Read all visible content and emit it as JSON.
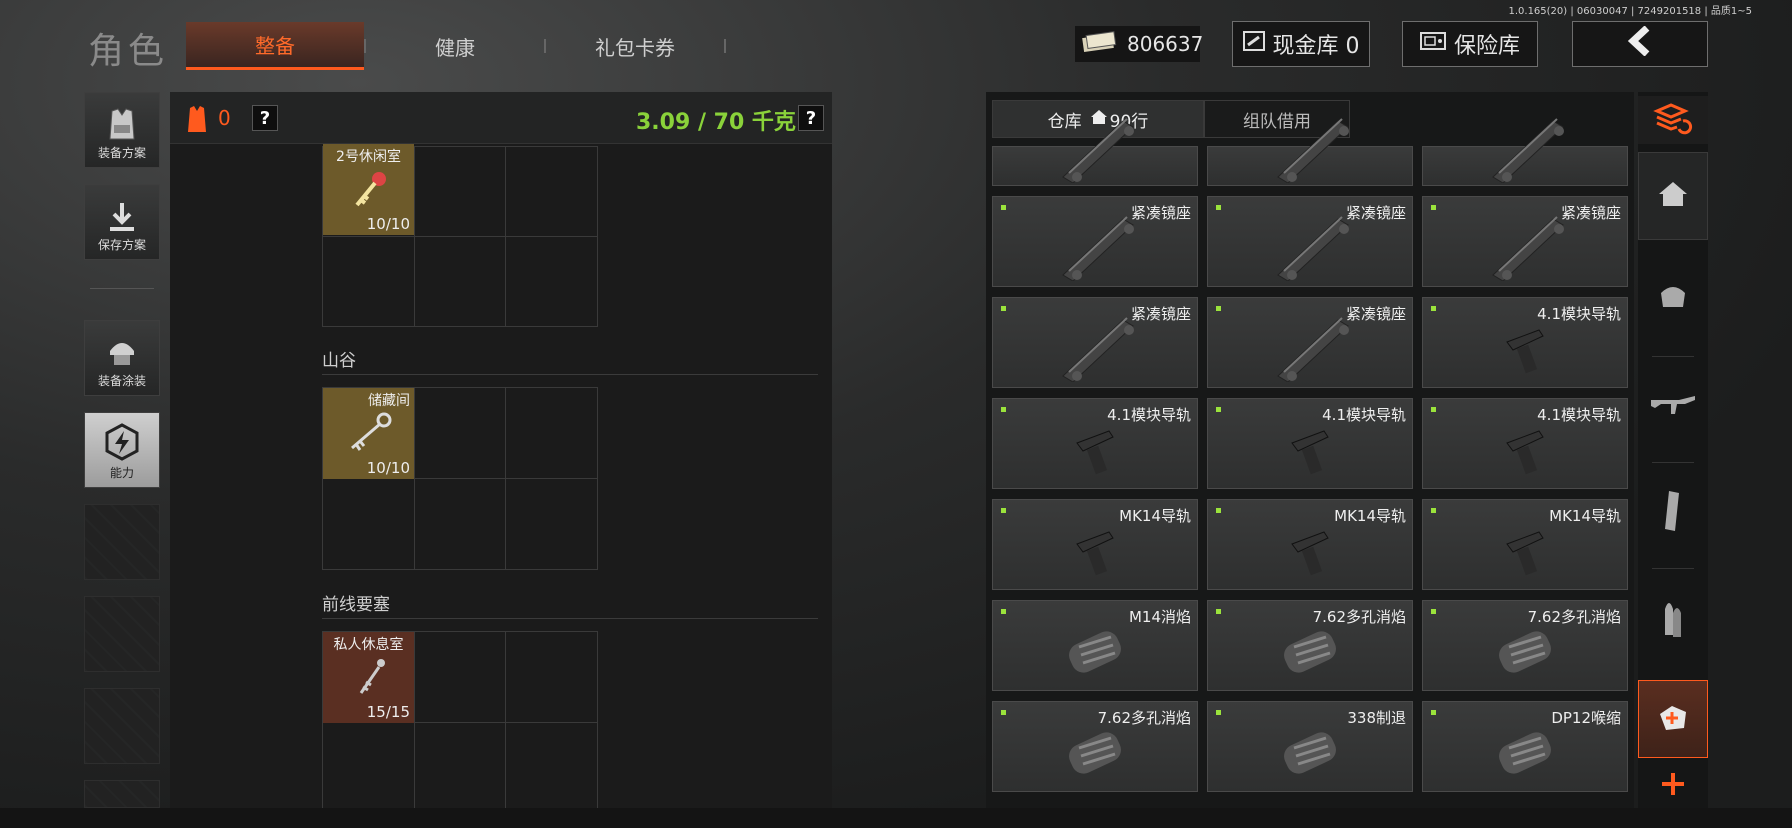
{
  "version": "1.0.165(20) | 06030047 | 7249201518 | 品质1~5",
  "header": {
    "title": "角色",
    "tabs": [
      {
        "label": "整备",
        "active": true
      },
      {
        "label": "健康",
        "active": false
      },
      {
        "label": "礼包卡券",
        "active": false
      }
    ],
    "money": "806637",
    "cash_vault": "现金库 0",
    "safe": "保险库",
    "back_icon": "chevron-left-icon"
  },
  "leftnav": [
    {
      "label": "装备方案",
      "icon": "vest-icon"
    },
    {
      "label": "保存方案",
      "icon": "download-icon"
    },
    {
      "label": "装备涂装",
      "icon": "helmet-icon"
    },
    {
      "label": "能力",
      "icon": "lightning-icon",
      "light": true
    }
  ],
  "equip": {
    "armor_count": "0",
    "help": "?",
    "weight": "3.09 / 70 千克",
    "sections": [
      {
        "title": "",
        "key_name": "2号休闲室",
        "key_count": "10/10",
        "color": "#6d5a2a"
      },
      {
        "title": "山谷",
        "key_name": "储藏间",
        "key_count": "10/10",
        "color": "#6d5a2a"
      },
      {
        "title": "前线要塞",
        "key_name": "私人休息室",
        "key_count": "15/15",
        "color": "#5a2f22"
      }
    ]
  },
  "storage": {
    "tab_warehouse": "仓库",
    "tab_rows": "90行",
    "tab_team": "组队借用",
    "items": [
      [
        "",
        "",
        ""
      ],
      [
        "紧凑镜座",
        "紧凑镜座",
        "紧凑镜座"
      ],
      [
        "紧凑镜座",
        "紧凑镜座",
        "4.1模块导轨"
      ],
      [
        "4.1模块导轨",
        "4.1模块导轨",
        "4.1模块导轨"
      ],
      [
        "MK14导轨",
        "MK14导轨",
        "MK14导轨"
      ],
      [
        "M14消焰",
        "7.62多孔消焰",
        "7.62多孔消焰"
      ],
      [
        "7.62多孔消焰",
        "338制退",
        "DP12喉缩"
      ]
    ]
  },
  "rightnav": [
    "layers-refresh-icon",
    "home-icon",
    "armor-icon",
    "rifle-icon",
    "magazine-icon",
    "ammo-icon",
    "medkit-icon",
    "plus-icon"
  ],
  "colors": {
    "accent": "#ff5a1e",
    "green": "#8ad23a"
  }
}
